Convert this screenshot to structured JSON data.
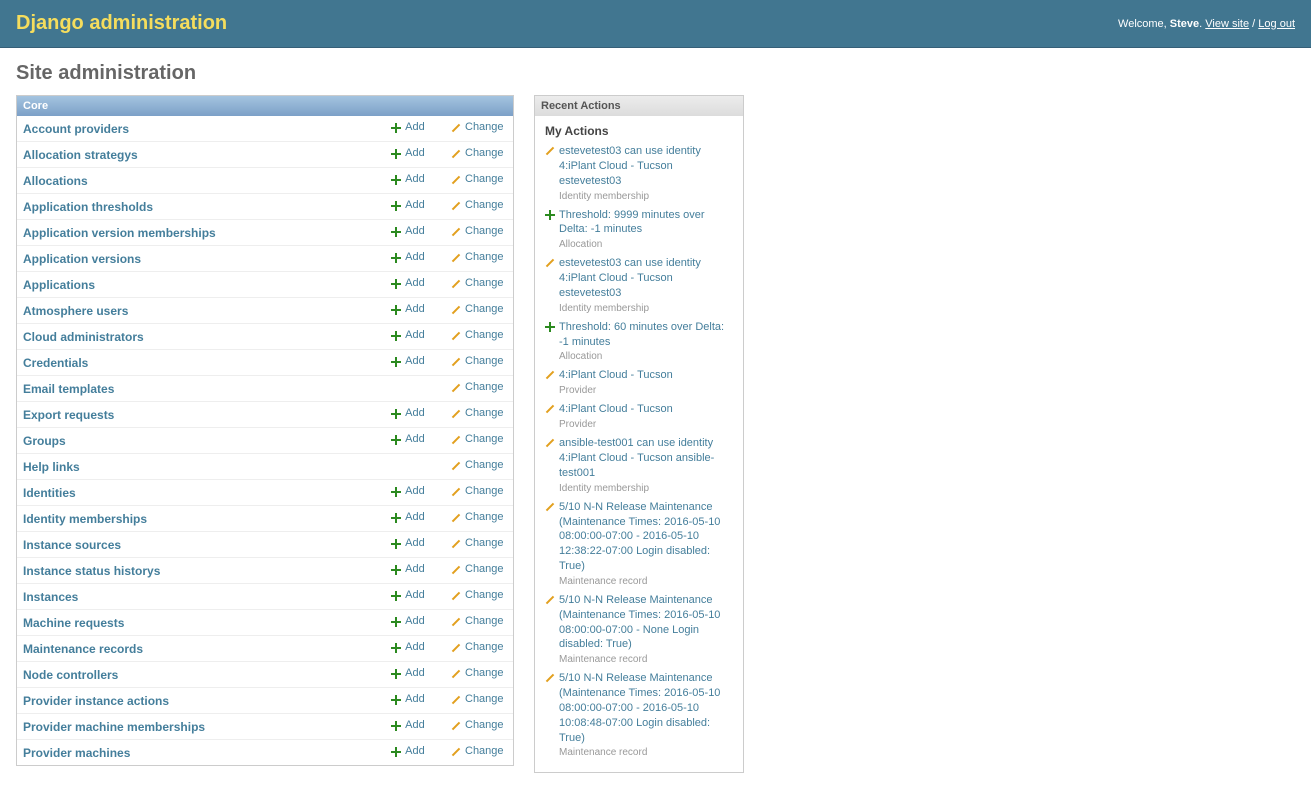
{
  "header": {
    "branding": "Django administration",
    "welcome": "Welcome,",
    "username": "Steve",
    "view_site": "View site",
    "log_out": "Log out"
  },
  "page_title": "Site administration",
  "app": {
    "caption": "Core",
    "add_label": "Add",
    "change_label": "Change",
    "models": [
      {
        "name": "Account providers",
        "add": true,
        "change": true
      },
      {
        "name": "Allocation strategys",
        "add": true,
        "change": true
      },
      {
        "name": "Allocations",
        "add": true,
        "change": true
      },
      {
        "name": "Application thresholds",
        "add": true,
        "change": true
      },
      {
        "name": "Application version memberships",
        "add": true,
        "change": true
      },
      {
        "name": "Application versions",
        "add": true,
        "change": true
      },
      {
        "name": "Applications",
        "add": true,
        "change": true
      },
      {
        "name": "Atmosphere users",
        "add": true,
        "change": true
      },
      {
        "name": "Cloud administrators",
        "add": true,
        "change": true
      },
      {
        "name": "Credentials",
        "add": true,
        "change": true
      },
      {
        "name": "Email templates",
        "add": false,
        "change": true
      },
      {
        "name": "Export requests",
        "add": true,
        "change": true
      },
      {
        "name": "Groups",
        "add": true,
        "change": true
      },
      {
        "name": "Help links",
        "add": false,
        "change": true
      },
      {
        "name": "Identities",
        "add": true,
        "change": true
      },
      {
        "name": "Identity memberships",
        "add": true,
        "change": true
      },
      {
        "name": "Instance sources",
        "add": true,
        "change": true
      },
      {
        "name": "Instance status historys",
        "add": true,
        "change": true
      },
      {
        "name": "Instances",
        "add": true,
        "change": true
      },
      {
        "name": "Machine requests",
        "add": true,
        "change": true
      },
      {
        "name": "Maintenance records",
        "add": true,
        "change": true
      },
      {
        "name": "Node controllers",
        "add": true,
        "change": true
      },
      {
        "name": "Provider instance actions",
        "add": true,
        "change": true
      },
      {
        "name": "Provider machine memberships",
        "add": true,
        "change": true
      },
      {
        "name": "Provider machines",
        "add": true,
        "change": true
      }
    ]
  },
  "recent_actions": {
    "caption": "Recent Actions",
    "subhead": "My Actions",
    "items": [
      {
        "icon": "change",
        "label": "estevetest03 can use identity 4:iPlant Cloud - Tucson estevetest03",
        "meta": "Identity membership"
      },
      {
        "icon": "add",
        "label": "Threshold: 9999 minutes over Delta: -1 minutes",
        "meta": "Allocation"
      },
      {
        "icon": "change",
        "label": "estevetest03 can use identity 4:iPlant Cloud - Tucson estevetest03",
        "meta": "Identity membership"
      },
      {
        "icon": "add",
        "label": "Threshold: 60 minutes over Delta: -1 minutes",
        "meta": "Allocation"
      },
      {
        "icon": "change",
        "label": "4:iPlant Cloud - Tucson",
        "meta": "Provider"
      },
      {
        "icon": "change",
        "label": "4:iPlant Cloud - Tucson",
        "meta": "Provider"
      },
      {
        "icon": "change",
        "label": "ansible-test001 can use identity 4:iPlant Cloud - Tucson ansible-test001",
        "meta": "Identity membership"
      },
      {
        "icon": "change",
        "label": "5/10 N-N Release Maintenance (Maintenance Times: 2016-05-10 08:00:00-07:00 - 2016-05-10 12:38:22-07:00 Login disabled: True)",
        "meta": "Maintenance record"
      },
      {
        "icon": "change",
        "label": "5/10 N-N Release Maintenance (Maintenance Times: 2016-05-10 08:00:00-07:00 - None Login disabled: True)",
        "meta": "Maintenance record"
      },
      {
        "icon": "change",
        "label": "5/10 N-N Release Maintenance (Maintenance Times: 2016-05-10 08:00:00-07:00 - 2016-05-10 10:08:48-07:00 Login disabled: True)",
        "meta": "Maintenance record"
      }
    ]
  }
}
